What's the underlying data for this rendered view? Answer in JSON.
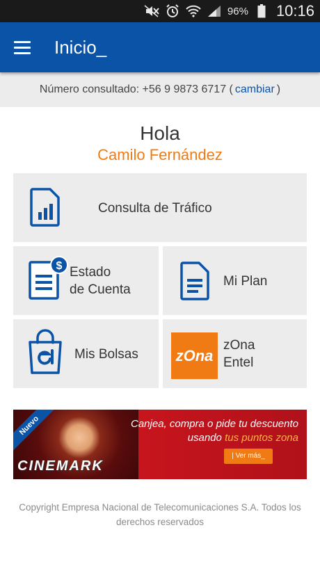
{
  "status_bar": {
    "battery_percent": "96%",
    "time": "10:16",
    "icons": [
      "mute-icon",
      "alarm-icon",
      "wifi-icon",
      "signal-icon",
      "battery-icon"
    ]
  },
  "app_bar": {
    "title": "Inicio_",
    "menu_icon": "hamburger-menu-icon",
    "bg_color": "#0b53a6"
  },
  "number_bar": {
    "label": "Número consultado: +56 9 9873 6717 (",
    "change_link": "cambiar",
    "suffix": ")"
  },
  "greeting": {
    "hello": "Hola",
    "name": "Camilo Fernández",
    "name_color": "#f07b14"
  },
  "tiles": {
    "traffic": {
      "label": "Consulta de Tráfico",
      "icon": "sim-chart-icon"
    },
    "statement": {
      "line1": "Estado",
      "line2": "de Cuenta",
      "icon": "bill-dollar-icon"
    },
    "plan": {
      "label": "Mi Plan",
      "icon": "document-icon"
    },
    "bags": {
      "label": "Mis Bolsas",
      "icon": "shopping-bag-icon"
    },
    "zona": {
      "line1": "zOna",
      "line2": "Entel",
      "logo_text": "zOna",
      "icon": "zona-logo"
    }
  },
  "banner": {
    "ribbon": "Nuevo",
    "brand": "CINEMARK",
    "tagline_line1": "Canjea, compra o pide tu descuento",
    "tagline_line2_prefix": "usando",
    "tagline_line2_highlight": "tus puntos zona",
    "cta": "| Ver más_"
  },
  "footer": {
    "copyright": "Copyright Empresa Nacional de Telecomunicaciones S.A. Todos los derechos reservados"
  }
}
